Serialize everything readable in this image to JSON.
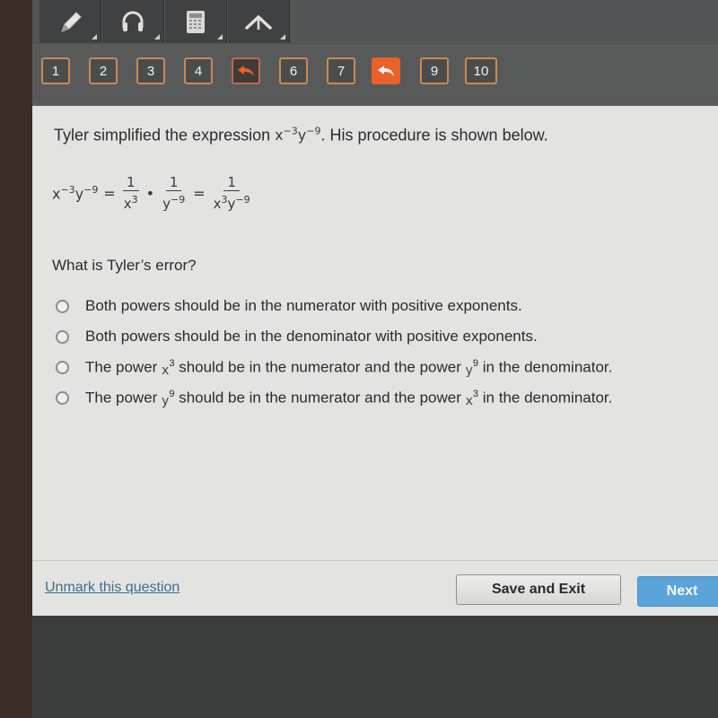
{
  "toolbar": {
    "tools": [
      {
        "name": "pencil",
        "icon": "pencil-icon"
      },
      {
        "name": "audio",
        "icon": "headphones-icon"
      },
      {
        "name": "calculator",
        "icon": "calculator-icon"
      },
      {
        "name": "reference",
        "icon": "caret-up-icon"
      }
    ]
  },
  "navigation": {
    "questions": [
      {
        "label": "1",
        "state": "normal"
      },
      {
        "label": "2",
        "state": "normal"
      },
      {
        "label": "3",
        "state": "normal"
      },
      {
        "label": "4",
        "state": "normal"
      },
      {
        "label": "",
        "state": "marked",
        "icon": "return-arrow-icon"
      },
      {
        "label": "6",
        "state": "normal"
      },
      {
        "label": "7",
        "state": "normal"
      },
      {
        "label": "",
        "state": "current",
        "icon": "return-arrow-icon"
      },
      {
        "label": "9",
        "state": "normal"
      },
      {
        "label": "10",
        "state": "normal"
      }
    ],
    "colors": {
      "border": "#c98b4e",
      "current": "#e8622a"
    }
  },
  "question": {
    "prompt_before": "Tyler simplified the expression ",
    "prompt_expr": {
      "x_base": "x",
      "x_exp": "−3",
      "y_base": "y",
      "y_exp": "−9"
    },
    "prompt_after": ". His procedure is shown below.",
    "procedure": {
      "lhs_x": "x",
      "lhs_x_exp": "−3",
      "lhs_y": "y",
      "lhs_y_exp": "−9",
      "eq1": "=",
      "frac1_num": "1",
      "frac1_den_base": "x",
      "frac1_den_exp": "3",
      "dot": "•",
      "frac2_num": "1",
      "frac2_den_base": "y",
      "frac2_den_exp": "−9",
      "eq2": "=",
      "frac3_num": "1",
      "frac3_den_x": "x",
      "frac3_den_x_exp": "3",
      "frac3_den_y": "y",
      "frac3_den_y_exp": "−9"
    },
    "ask": "What is Tyler’s error?",
    "options": [
      {
        "text": "Both powers should be in the numerator with positive exponents."
      },
      {
        "text": "Both powers should be in the denominator with positive exponents."
      },
      {
        "p1": "The power ",
        "v1": "x",
        "e1": "3",
        "p2": " should be in the numerator and the power ",
        "v2": "y",
        "e2": "9",
        "p3": " in the denominator."
      },
      {
        "p1": "The power ",
        "v1": "y",
        "e1": "9",
        "p2": " should be in the numerator and the power ",
        "v2": "x",
        "e2": "3",
        "p3": " in the denominator."
      }
    ]
  },
  "footer": {
    "unmark_label": "Unmark this question",
    "save_label": "Save and Exit",
    "next_label": "Next"
  }
}
